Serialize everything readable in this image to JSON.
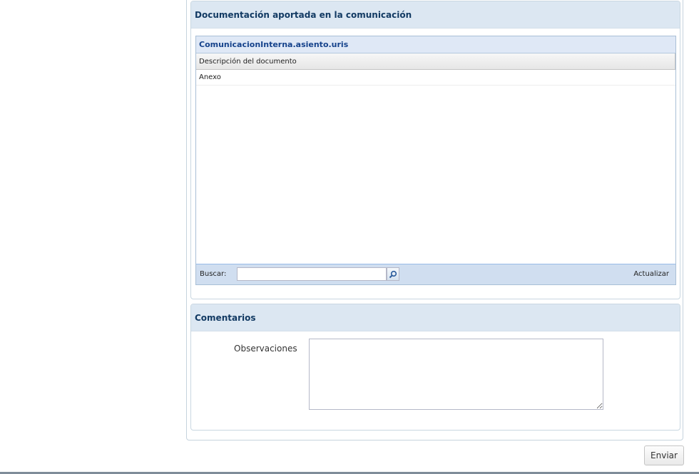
{
  "documentation_panel": {
    "title": "Documentación aportada en la comunicación",
    "grid": {
      "title": "ComunicacionInterna.asiento.uris",
      "column_header": "Descripción del documento",
      "rows": [
        "Anexo"
      ],
      "search_label": "Buscar:",
      "search_value": "",
      "refresh_label": "Actualizar"
    }
  },
  "comments_panel": {
    "title": "Comentarios",
    "observaciones_label": "Observaciones",
    "observaciones_value": ""
  },
  "footer": {
    "submit_label": "Enviar"
  }
}
